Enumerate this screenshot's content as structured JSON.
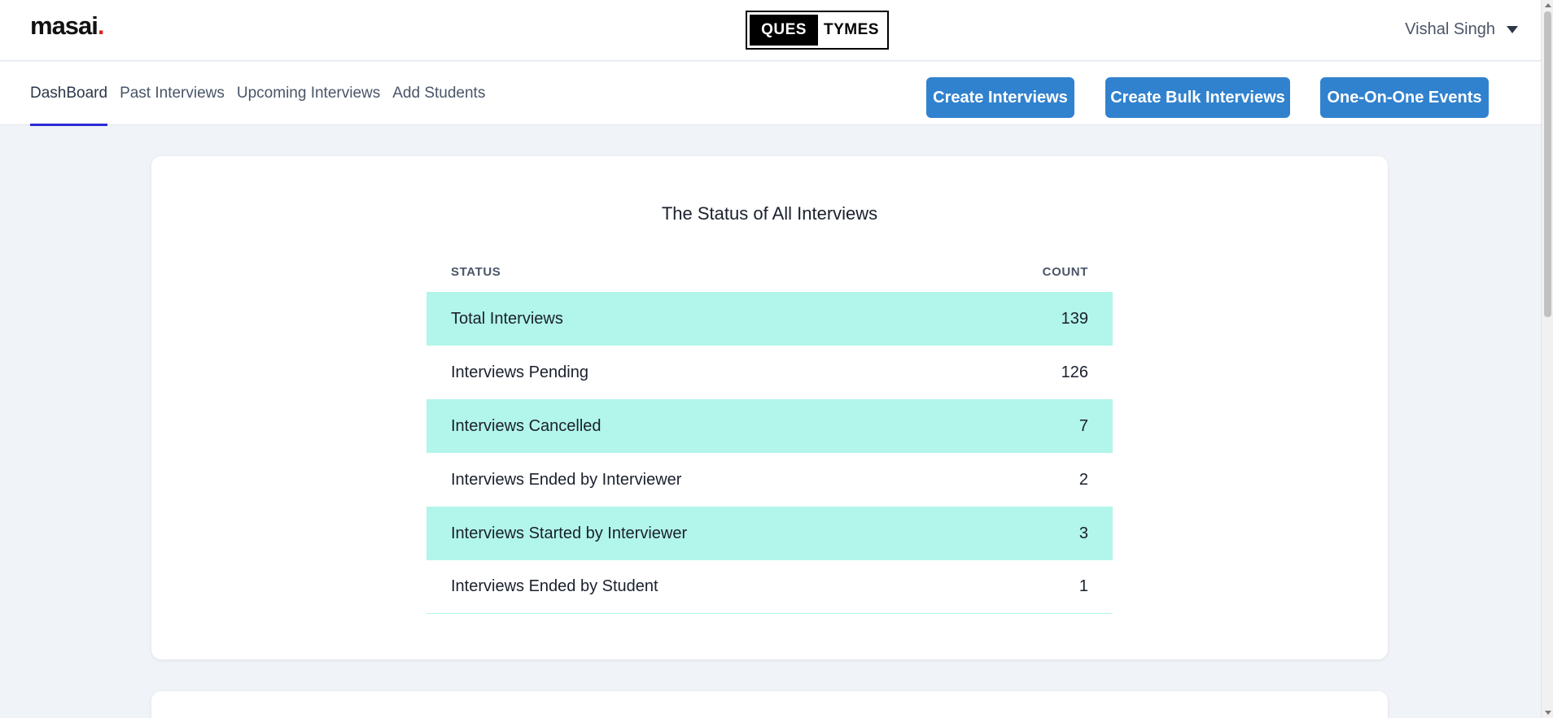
{
  "header": {
    "logo_text": "masai",
    "logo_dot": ".",
    "brand_left": "QUES",
    "brand_right": "TYMES",
    "user_name": "Vishal Singh"
  },
  "nav": {
    "tabs": [
      {
        "label": "DashBoard",
        "active": true
      },
      {
        "label": "Past Interviews"
      },
      {
        "label": "Upcoming Interviews"
      },
      {
        "label": "Add Students"
      }
    ],
    "buttons": {
      "create_interviews": "Create Interviews",
      "create_bulk_interviews": "Create Bulk Interviews",
      "one_on_one_events": "One-On-One Events"
    }
  },
  "status_card": {
    "title": "The Status of All Interviews",
    "columns": {
      "status": "STATUS",
      "count": "COUNT"
    },
    "rows": [
      {
        "status": "Total Interviews",
        "count": "139"
      },
      {
        "status": "Interviews Pending",
        "count": "126"
      },
      {
        "status": "Interviews Cancelled",
        "count": "7"
      },
      {
        "status": "Interviews Ended by Interviewer",
        "count": "2"
      },
      {
        "status": "Interviews Started by Interviewer",
        "count": "3"
      },
      {
        "status": "Interviews Ended by Student",
        "count": "1"
      }
    ]
  },
  "colors": {
    "primary_button": "#3182ce",
    "stripe": "#b2f5ea",
    "active_tab_underline": "#2b2bd6",
    "background": "#f0f3f8"
  }
}
